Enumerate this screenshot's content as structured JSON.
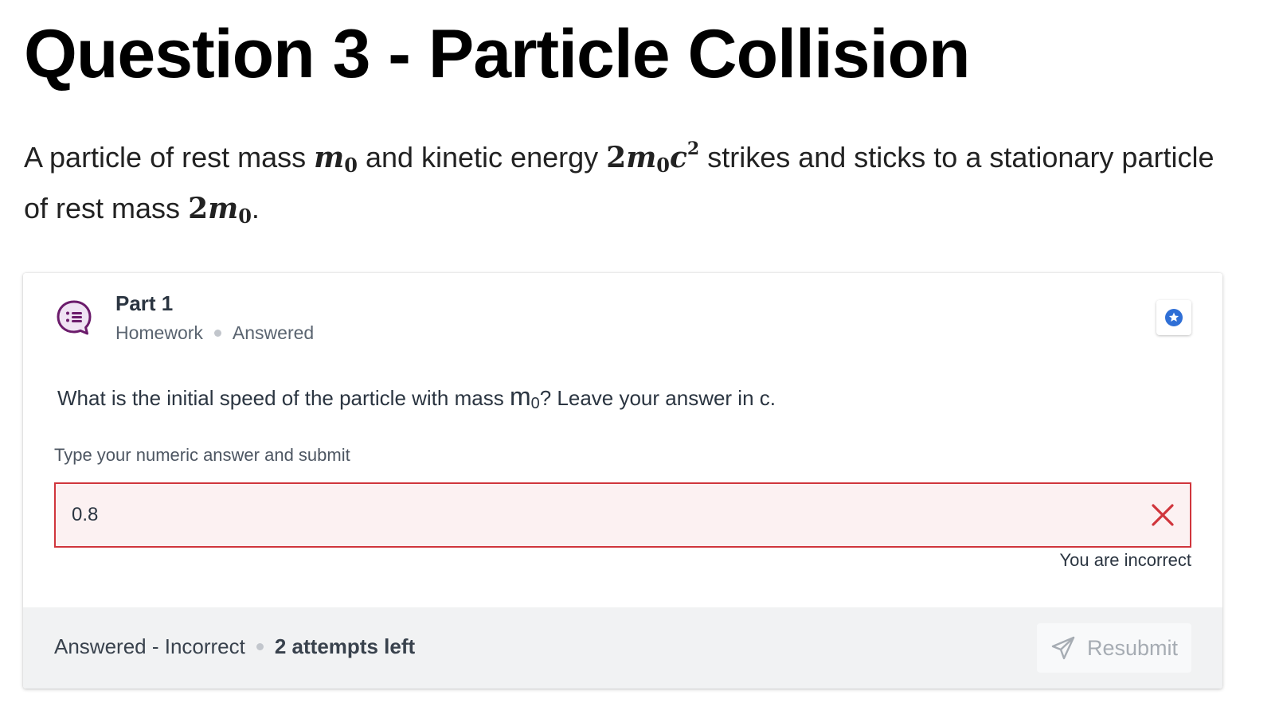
{
  "page": {
    "title": "Question 3 - Particle Collision"
  },
  "intro": {
    "text_1": "A particle of rest mass ",
    "math_1": "m",
    "math_1_sub": "0",
    "text_2": " and kinetic energy ",
    "math_2_coef": "2",
    "math_2": "m",
    "math_2_sub": "0",
    "math_2_c": "c",
    "math_2_sup": "2",
    "text_3": " strikes and sticks to a stationary particle of rest mass ",
    "math_3_coef": "2",
    "math_3": "m",
    "math_3_sub": "0",
    "text_4": "."
  },
  "part": {
    "title": "Part 1",
    "type": "Homework",
    "state": "Answered",
    "icon": "question-chat-icon",
    "accent_color": "#6b1b6b",
    "star_icon": "star-badge-icon",
    "star_color": "#2f6fd6"
  },
  "question": {
    "text_before": "What is the initial speed of the particle with mass ",
    "var": "m",
    "var_sub": "0",
    "text_after": "? Leave your answer in c."
  },
  "answer": {
    "label": "Type your numeric answer and submit",
    "value": "0.8",
    "status_icon": "close-x-icon",
    "error_color": "#d0353c",
    "feedback": "You are incorrect"
  },
  "footer": {
    "status": "Answered - Incorrect",
    "attempts": "2 attempts left",
    "resubmit_label": "Resubmit",
    "resubmit_icon": "paper-plane-icon"
  }
}
